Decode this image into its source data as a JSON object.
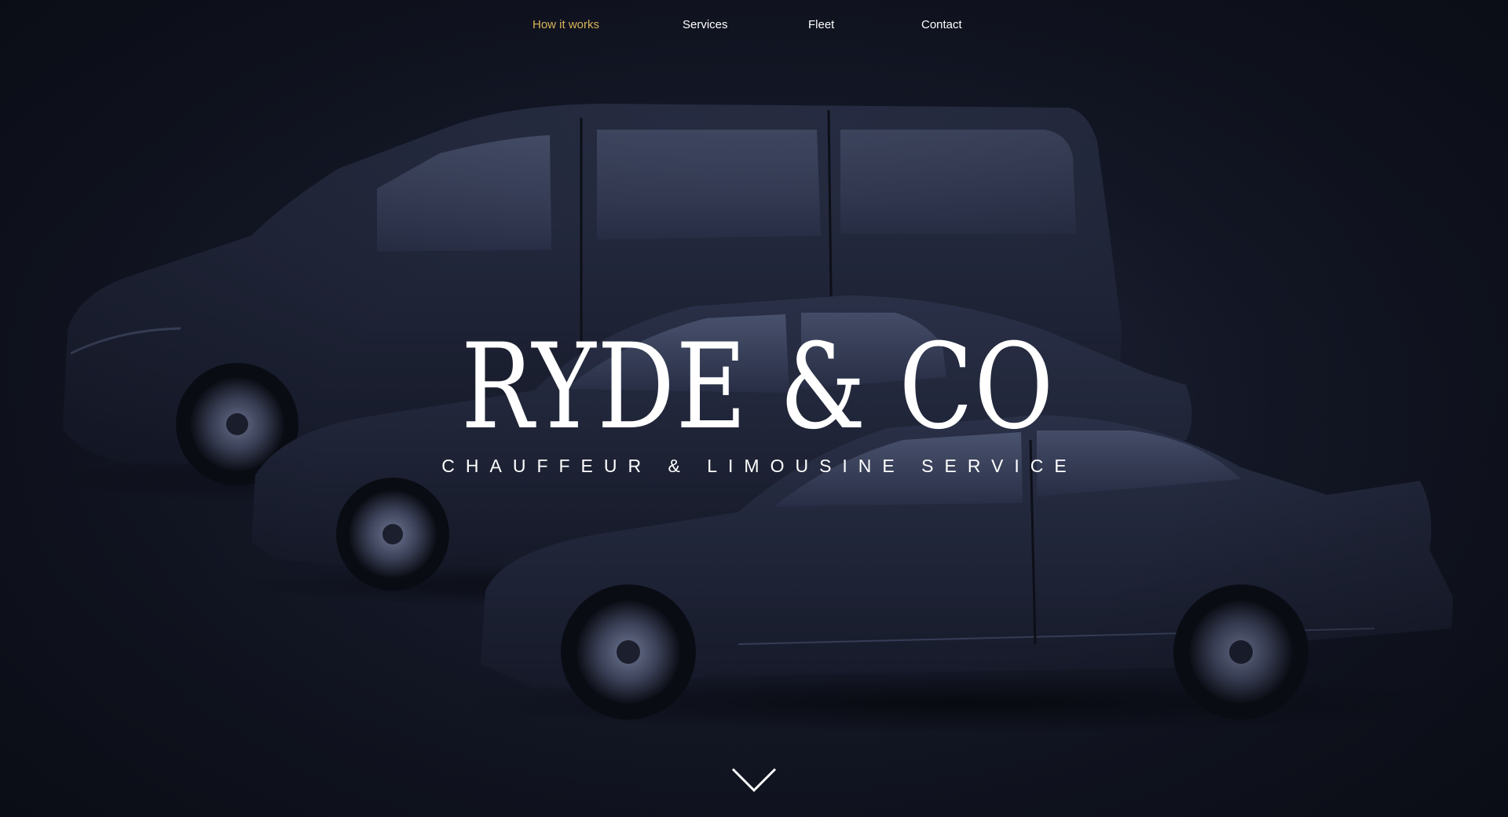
{
  "nav": {
    "items": [
      {
        "label": "How it works",
        "active": true
      },
      {
        "label": "Services",
        "active": false
      },
      {
        "label": "Fleet",
        "active": false
      },
      {
        "label": "Contact",
        "active": false
      }
    ]
  },
  "hero": {
    "title": "RYDE & CO",
    "subtitle": "CHAUFFEUR & LIMOUSINE SERVICE",
    "scroll_icon": "chevron-down-icon"
  },
  "colors": {
    "background": "#0f1220",
    "accent": "#d8b35a",
    "text": "#ffffff"
  }
}
